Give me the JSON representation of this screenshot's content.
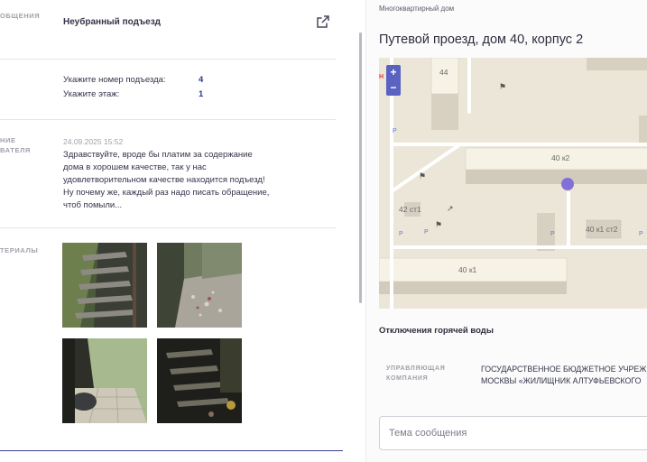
{
  "left": {
    "rows": {
      "subject_label": "ОБЩЕНИЯ",
      "subject_value": "Неубранный подъезд",
      "message_label_1": "НИЕ",
      "message_label_2": "ВАТЕЛЯ",
      "materials_label": "ТЕРИАЛЫ"
    },
    "fields": [
      {
        "label": "Укажите номер подъезда:",
        "value": "4"
      },
      {
        "label": "Укажите этаж:",
        "value": "1"
      }
    ],
    "message": {
      "date": "24.09.2025 15:52",
      "text": "Здравствуйте, вроде бы платим за содержание дома в хорошем качестве, так у нас удовлетворительном качестве находится подъезд! Ну почему же, каждый раз надо писать обращение, чтоб помыли..."
    },
    "photos": [
      "photo-1",
      "photo-2",
      "photo-3",
      "photo-4"
    ]
  },
  "right": {
    "building_type": "Многоквартирный дом",
    "address": "Путевой проезд, дом 40, корпус 2",
    "map": {
      "zoom_in": "+",
      "zoom_out": "−",
      "labels": {
        "b44": "44",
        "b40k2": "40 к2",
        "b42st1": "42 ст1",
        "b40k1st2": "40 к1 ст2",
        "b40k1": "40 к1",
        "n_marker": "Н"
      },
      "parking": "P"
    },
    "hot_water": "Отключения горячей воды",
    "management": {
      "label_1": "УПРАВЛЯЮЩАЯ",
      "label_2": "КОМПАНИЯ",
      "value_1": "ГОСУДАРСТВЕННОЕ БЮДЖЕТНОЕ УЧРЕЖ",
      "value_2": "МОСКВЫ «ЖИЛИЩНИК АЛТУФЬЕВСКОГО"
    },
    "subject_placeholder": "Тема сообщения"
  },
  "colors": {
    "accent": "#3d3f8f",
    "value_blue": "#2a3a8f",
    "map_marker": "#8270d8"
  }
}
